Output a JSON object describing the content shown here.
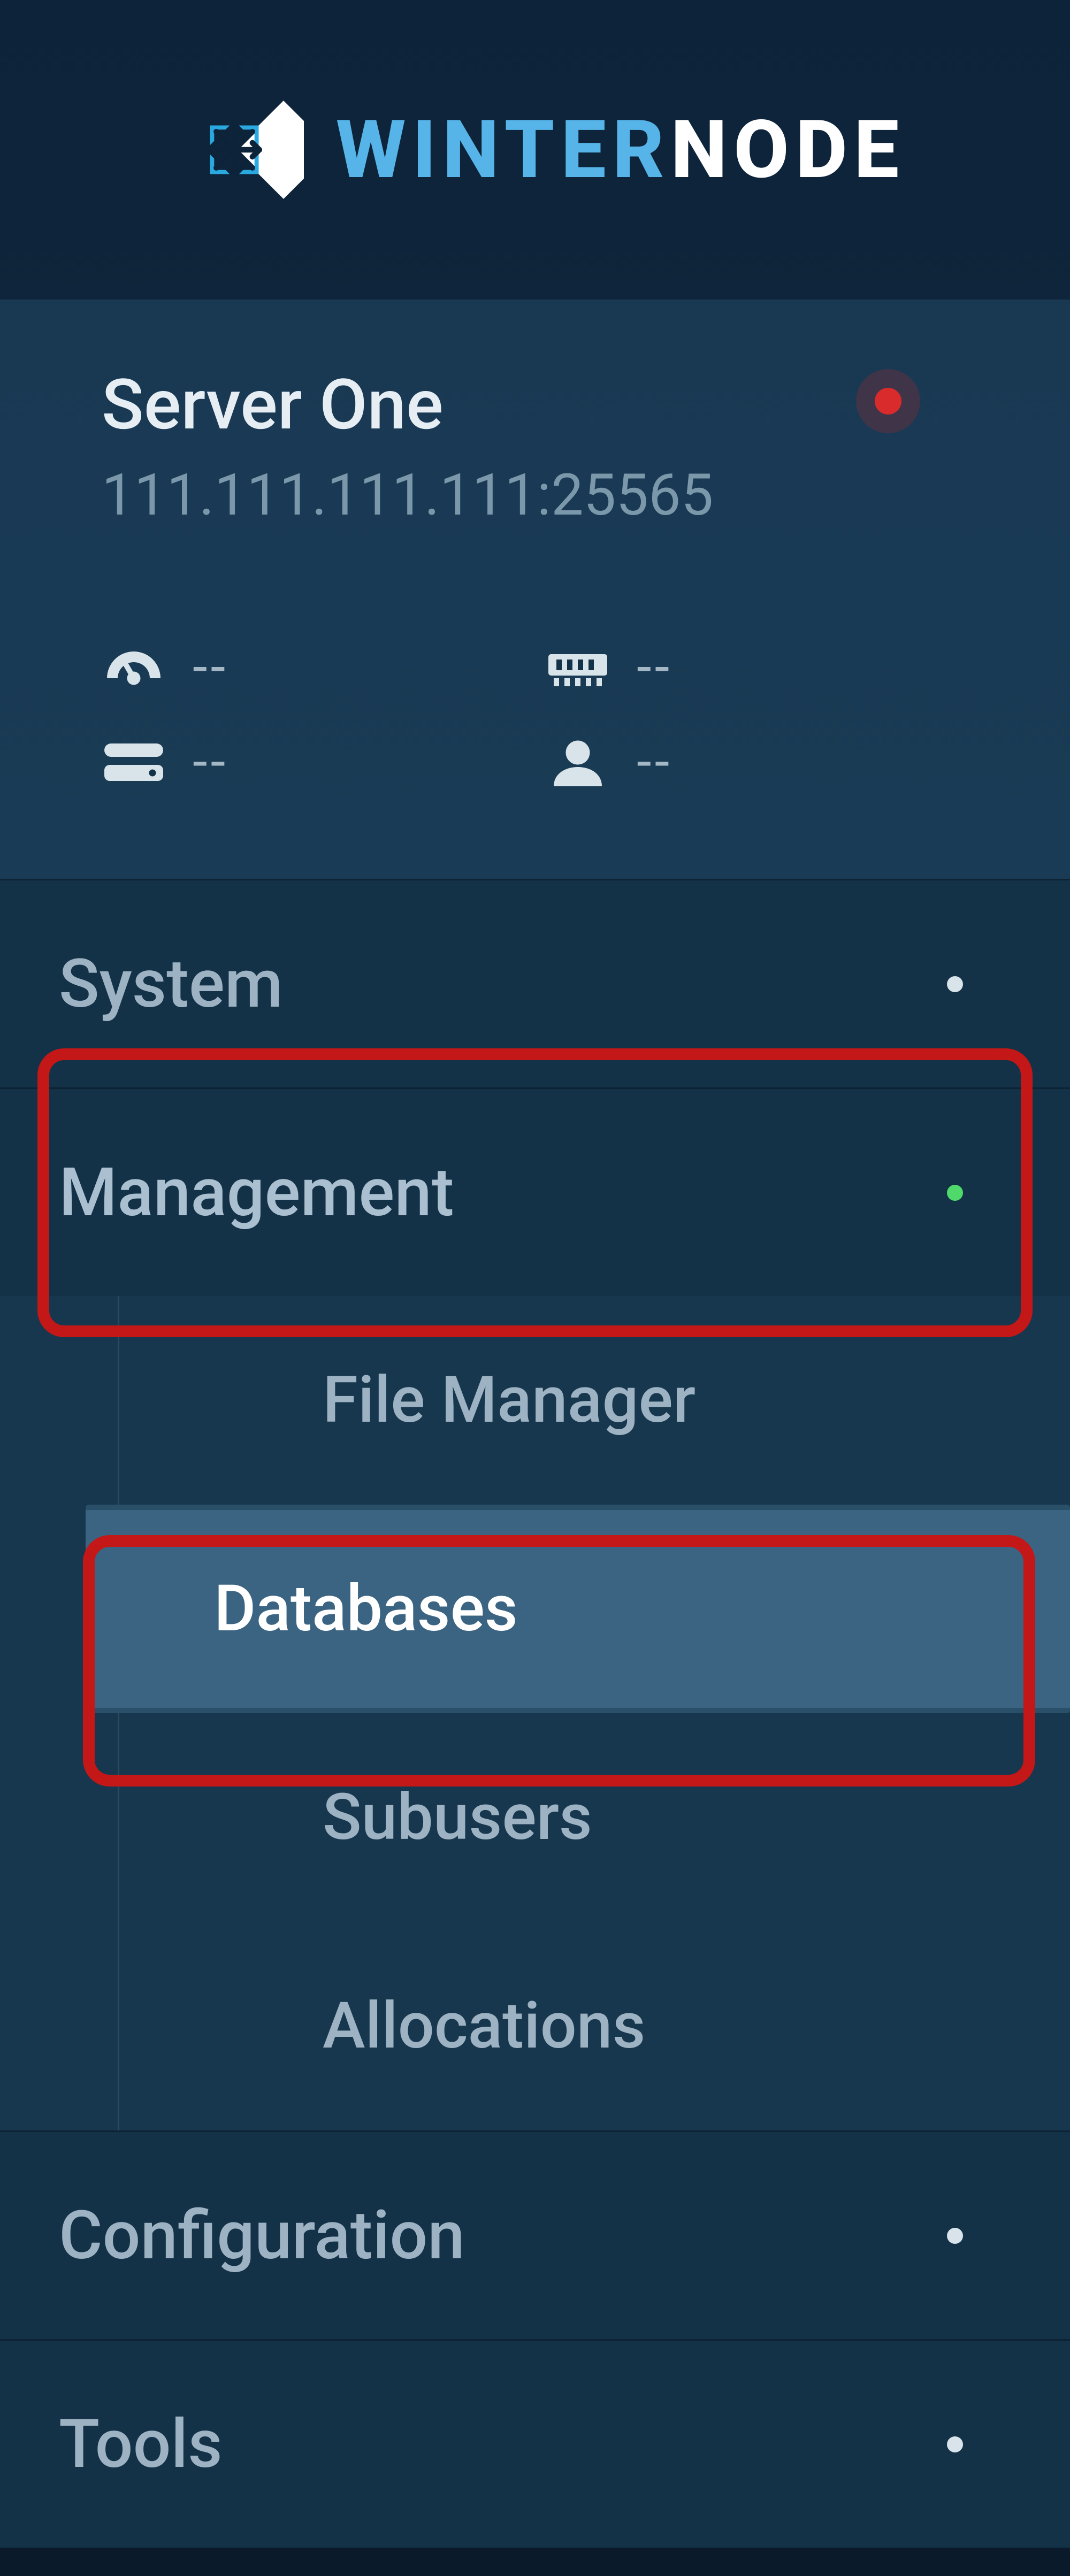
{
  "brand": {
    "part1": "WINTER",
    "part2": "NODE"
  },
  "server": {
    "name": "Server One",
    "address": "111.111.111.111:25565",
    "status": "offline"
  },
  "stats": {
    "cpu": "--",
    "memory": "--",
    "disk": "--",
    "users": "--"
  },
  "nav": {
    "system": {
      "label": "System"
    },
    "management": {
      "label": "Management"
    },
    "configuration": {
      "label": "Configuration"
    },
    "tools": {
      "label": "Tools"
    },
    "sub": {
      "file_manager": "File Manager",
      "databases": "Databases",
      "subusers": "Subusers",
      "allocations": "Allocations"
    }
  }
}
